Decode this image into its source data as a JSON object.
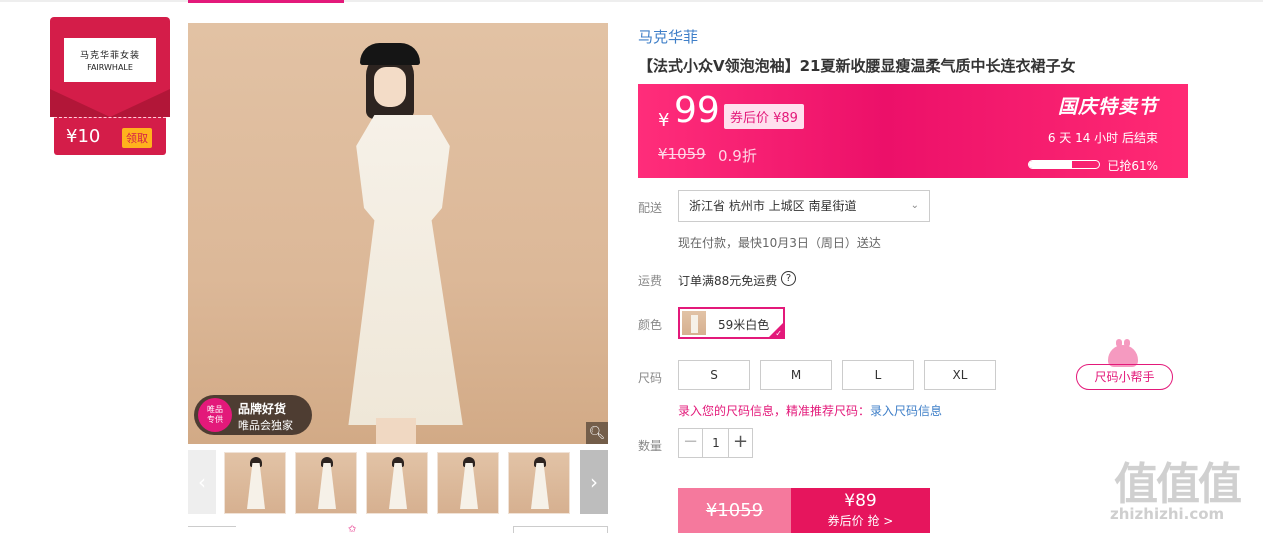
{
  "store": {
    "logo_cn": "马克华菲女装",
    "logo_en": "FAIRWHALE",
    "coupon_amount": "¥10",
    "coupon_claim": "领取"
  },
  "gallery": {
    "badge_circle": "唯品\n专供",
    "badge_title": "品牌好货",
    "badge_subtitle": "唯品会独家",
    "thumb_count": 5
  },
  "product": {
    "brand": "马克华菲",
    "title": "【法式小众V领泡泡袖】21夏新收腰显瘦温柔气质中长连衣裙子女"
  },
  "price_banner": {
    "yen": "¥",
    "price": "99",
    "after_coupon": "券后价 ¥89",
    "original_price": "¥1059",
    "discount": "0.9折",
    "event_name": "国庆特卖节",
    "countdown": "6 天 14 小时 后结束",
    "sold_fraction": 0.61,
    "sold_text": "已抢61%",
    "bg_color": "#ec1069"
  },
  "delivery": {
    "label": "配送",
    "address": "浙江省 杭州市 上城区 南星街道",
    "note": "现在付款，最快10月3日（周日）送达"
  },
  "shipping": {
    "label": "运费",
    "text": "订单满88元免运费"
  },
  "color": {
    "label": "颜色",
    "selected": "59米白色"
  },
  "size": {
    "label": "尺码",
    "options": [
      "S",
      "M",
      "L",
      "XL"
    ],
    "helper": "尺码小帮手",
    "tip_prefix": "录入您的尺码信息，精准推荐尺码：",
    "tip_link": "录入尺码信息"
  },
  "quantity": {
    "label": "数量",
    "minus": "−",
    "value": "1",
    "plus": "+"
  },
  "buy": {
    "original_price": "¥1059",
    "price": "¥89",
    "label": "券后价 抢 >"
  },
  "watermark": {
    "chars": "值值值",
    "url": "zhizhizhi.com"
  },
  "accent_color": "#e3197a"
}
